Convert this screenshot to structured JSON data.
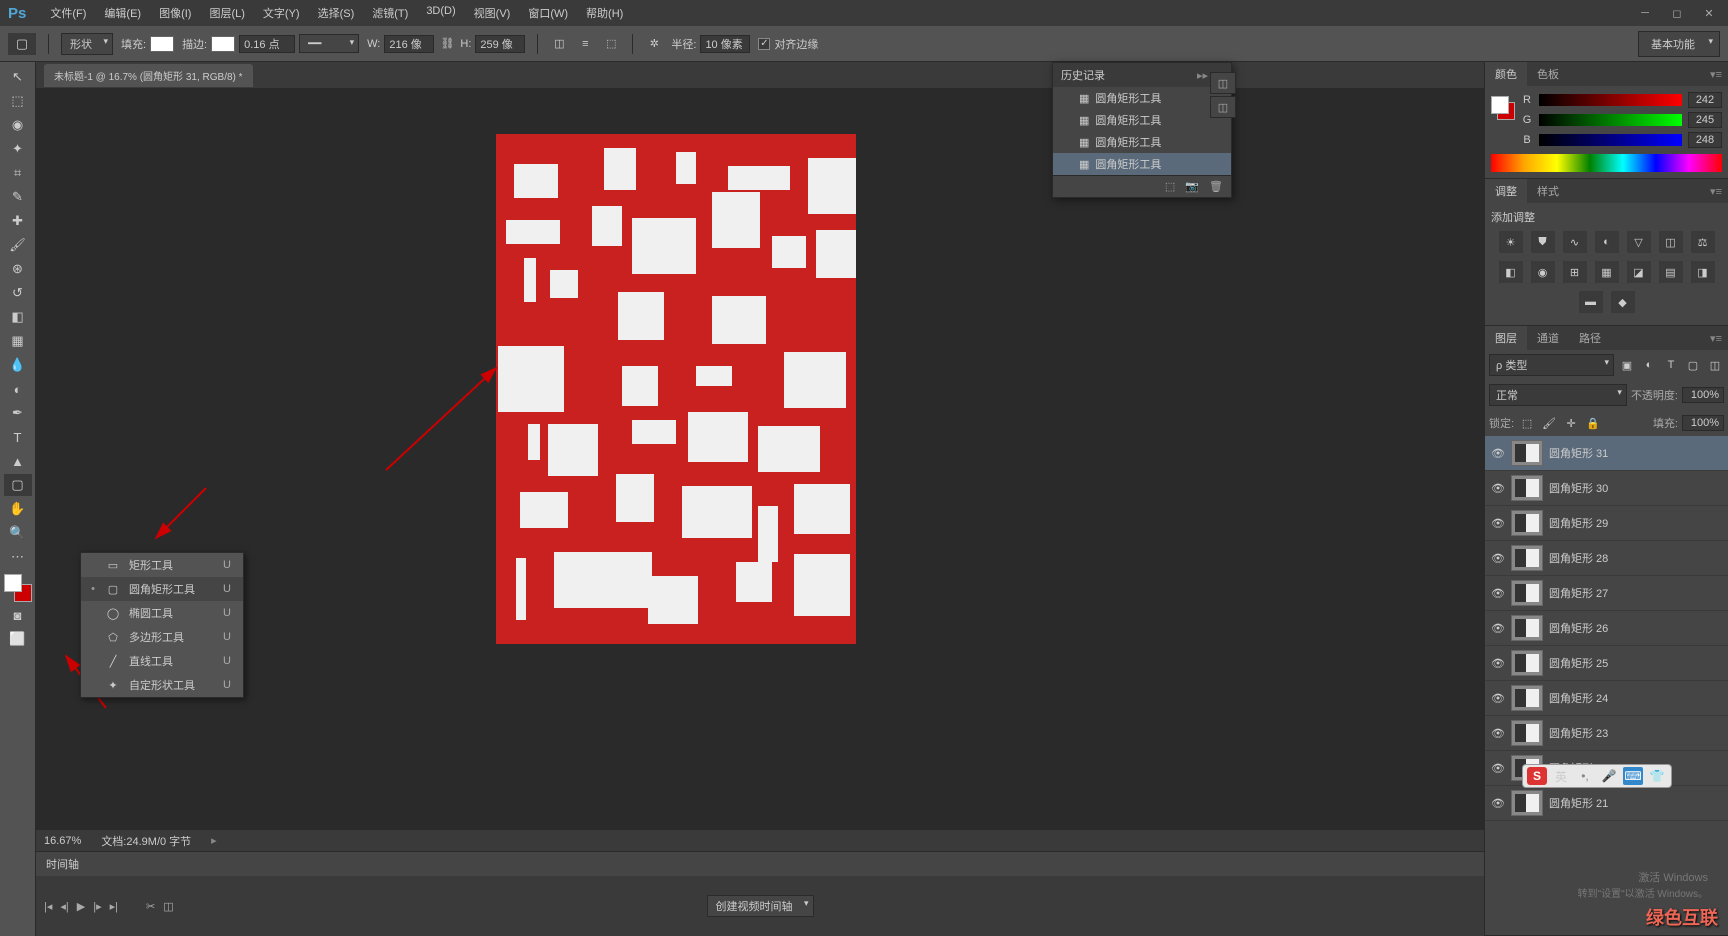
{
  "titlebar": {
    "logo": "Ps"
  },
  "menu": [
    "文件(F)",
    "编辑(E)",
    "图像(I)",
    "图层(L)",
    "文字(Y)",
    "选择(S)",
    "滤镜(T)",
    "3D(D)",
    "视图(V)",
    "窗口(W)",
    "帮助(H)"
  ],
  "options": {
    "mode": "形状",
    "fill_label": "填充:",
    "stroke_label": "描边:",
    "stroke_value": "0.16 点",
    "w_label": "W:",
    "w_value": "216 像",
    "h_label": "H:",
    "h_value": "259 像",
    "radius_label": "半径:",
    "radius_value": "10 像素",
    "align_label": "对齐边缘",
    "workspace": "基本功能"
  },
  "doc_tab": "未标题-1 @ 16.7% (圆角矩形 31, RGB/8) *",
  "shape_tools": [
    {
      "icon": "▭",
      "label": "矩形工具",
      "key": "U",
      "sel": false
    },
    {
      "icon": "▢",
      "label": "圆角矩形工具",
      "key": "U",
      "sel": true
    },
    {
      "icon": "◯",
      "label": "椭圆工具",
      "key": "U",
      "sel": false
    },
    {
      "icon": "⬠",
      "label": "多边形工具",
      "key": "U",
      "sel": false
    },
    {
      "icon": "╱",
      "label": "直线工具",
      "key": "U",
      "sel": false
    },
    {
      "icon": "✦",
      "label": "自定形状工具",
      "key": "U",
      "sel": false
    }
  ],
  "history": {
    "title": "历史记录",
    "items": [
      "圆角矩形工具",
      "圆角矩形工具",
      "圆角矩形工具",
      "圆角矩形工具"
    ]
  },
  "color": {
    "tabs": [
      "颜色",
      "色板"
    ],
    "r": "242",
    "g": "245",
    "b": "248"
  },
  "adjust": {
    "tabs": [
      "调整",
      "样式"
    ],
    "title": "添加调整"
  },
  "layers": {
    "tabs": [
      "图层",
      "通道",
      "路径"
    ],
    "kind": "ρ 类型",
    "blend": "正常",
    "opacity_label": "不透明度:",
    "opacity": "100%",
    "lock_label": "锁定:",
    "fill_label": "填充:",
    "fill": "100%",
    "items": [
      {
        "name": "圆角矩形 31",
        "sel": true
      },
      {
        "name": "圆角矩形 30",
        "sel": false
      },
      {
        "name": "圆角矩形 29",
        "sel": false
      },
      {
        "name": "圆角矩形 28",
        "sel": false
      },
      {
        "name": "圆角矩形 27",
        "sel": false
      },
      {
        "name": "圆角矩形 26",
        "sel": false
      },
      {
        "name": "圆角矩形 25",
        "sel": false
      },
      {
        "name": "圆角矩形 24",
        "sel": false
      },
      {
        "name": "圆角矩形 23",
        "sel": false
      },
      {
        "name": "圆角矩形 22",
        "sel": false
      },
      {
        "name": "圆角矩形 21",
        "sel": false
      }
    ]
  },
  "status": {
    "zoom": "16.67%",
    "doc": "文档:24.9M/0 字节"
  },
  "timeline": {
    "tab": "时间轴",
    "create": "创建视频时间轴"
  },
  "ime": {
    "lang": "英"
  },
  "activate": {
    "l1": "激活 Windows",
    "l2": "转到\"设置\"以激活 Windows。"
  },
  "watermark": "绿色互联"
}
